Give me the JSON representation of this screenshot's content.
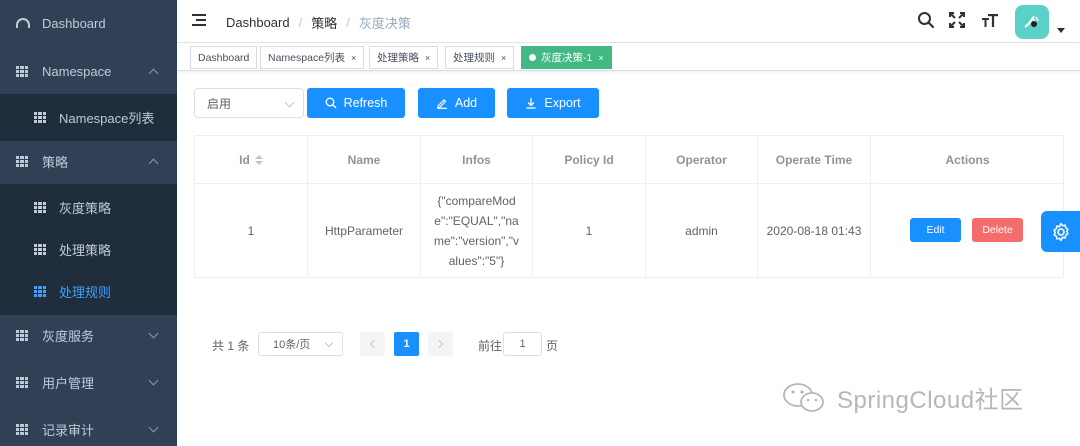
{
  "sidebar": {
    "items": [
      {
        "label": "Dashboard"
      },
      {
        "label": "Namespace"
      },
      {
        "label": "Namespace列表"
      },
      {
        "label": "策略"
      },
      {
        "label": "灰度策略"
      },
      {
        "label": "处理策略"
      },
      {
        "label": "处理规则"
      },
      {
        "label": "灰度服务"
      },
      {
        "label": "用户管理"
      },
      {
        "label": "记录审计"
      }
    ]
  },
  "navbar": {
    "breadcrumb": [
      "Dashboard",
      "策略",
      "灰度决策"
    ],
    "separator": "/"
  },
  "tags": [
    {
      "label": "Dashboard"
    },
    {
      "label": "Namespace列表",
      "close": "×"
    },
    {
      "label": "处理策略",
      "close": "×"
    },
    {
      "label": "处理规则",
      "close": "×"
    },
    {
      "label": "灰度决策-1",
      "close": "×"
    }
  ],
  "filter": {
    "status_select": "启用",
    "refresh_label": "Refresh",
    "add_label": "Add",
    "export_label": "Export"
  },
  "table": {
    "columns": [
      "Id",
      "Name",
      "Infos",
      "Policy Id",
      "Operator",
      "Operate Time",
      "Actions"
    ],
    "rows": [
      {
        "id": "1",
        "name": "HttpParameter",
        "infos": "{\"compareMode\":\"EQUAL\",\"name\":\"version\",\"values\":\"5\"}",
        "policy_id": "1",
        "operator": "admin",
        "operate_time": "2020-08-18 01:43",
        "edit_label": "Edit",
        "delete_label": "Delete"
      }
    ]
  },
  "pagination": {
    "total_text": "共 1 条",
    "page_size": "10条/页",
    "current_page": "1",
    "goto_label": "前往",
    "goto_value": "1",
    "page_suffix": "页"
  },
  "watermark": {
    "text": "SpringCloud社区"
  },
  "colors": {
    "sidebar_bg": "#304156",
    "sidebar_sub_bg": "#1f2d3d",
    "sidebar_text": "#bfcbd9",
    "active": "#409eff",
    "primary": "#1890ff",
    "danger": "#f56c6c",
    "tag_active": "#42b983",
    "avatar": "#5ad0c8"
  }
}
